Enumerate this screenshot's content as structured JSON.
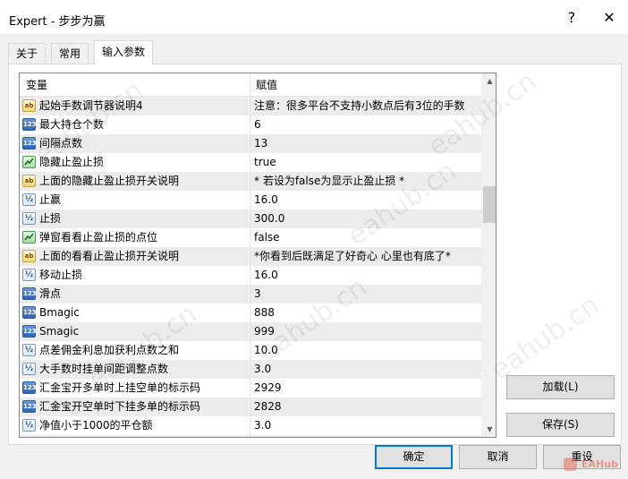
{
  "window": {
    "title": "Expert - 步步为赢",
    "help": "?",
    "close": "✕"
  },
  "tabs": [
    {
      "label": "关于"
    },
    {
      "label": "常用"
    },
    {
      "label": "输入参数"
    }
  ],
  "grid": {
    "col_name": "变量",
    "col_value": "赋值",
    "rows": [
      {
        "icon": "ab",
        "name": "起始手数调节器说明4",
        "value": "注意：很多平台不支持小数点后有3位的手数"
      },
      {
        "icon": "123",
        "name": "最大持仓个数",
        "value": "6"
      },
      {
        "icon": "123",
        "name": "间隔点数",
        "value": "13"
      },
      {
        "icon": "bool",
        "name": "隐藏止盈止损",
        "value": "true"
      },
      {
        "icon": "ab",
        "name": "上面的隐藏止盈止损开关说明",
        "value": "* 若设为false为显示止盈止损 *"
      },
      {
        "icon": "v2",
        "name": "止赢",
        "value": "16.0"
      },
      {
        "icon": "v2",
        "name": "止损",
        "value": "300.0"
      },
      {
        "icon": "bool",
        "name": "弹窗看看止盈止损的点位",
        "value": "false"
      },
      {
        "icon": "ab",
        "name": "上面的看看止盈止损开关说明",
        "value": "*你看到后既满足了好奇心 心里也有底了*"
      },
      {
        "icon": "v2",
        "name": "移动止损",
        "value": "16.0"
      },
      {
        "icon": "123",
        "name": "滑点",
        "value": "3"
      },
      {
        "icon": "123",
        "name": "Bmagic",
        "value": "888"
      },
      {
        "icon": "123",
        "name": "Smagic",
        "value": "999"
      },
      {
        "icon": "v2",
        "name": "点差佣金利息加获利点数之和",
        "value": "10.0"
      },
      {
        "icon": "v2",
        "name": "大手数时挂单间距调整点数",
        "value": "3.0"
      },
      {
        "icon": "123",
        "name": "汇金宝开多单时上挂空单的标示码",
        "value": "2929"
      },
      {
        "icon": "123",
        "name": "汇金宝开空单时下挂多单的标示码",
        "value": "2828"
      },
      {
        "icon": "v2",
        "name": "净值小于1000的平仓额",
        "value": "3.0"
      },
      {
        "icon": "v2",
        "name": "",
        "value": ""
      }
    ]
  },
  "buttons": {
    "load": "加载(L)",
    "save": "保存(S)",
    "ok": "确定",
    "cancel": "取消",
    "reset": "重设"
  },
  "watermark": "eahub.cn",
  "logo": "EAHub",
  "colors": {
    "accent": "#0078d7",
    "row_alt": "#ececec",
    "window_bg": "#f0f0f0"
  }
}
